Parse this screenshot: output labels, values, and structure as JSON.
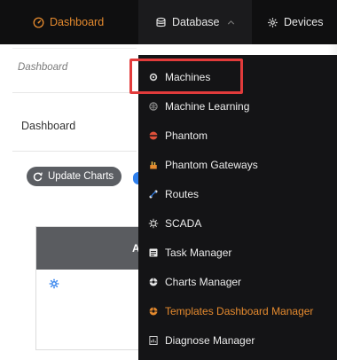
{
  "nav": {
    "dashboard": "Dashboard",
    "database": "Database",
    "devices": "Devices"
  },
  "page": {
    "breadcrumb": "Dashboard",
    "section_title": "Dashboard",
    "update_button": "Update Charts",
    "card_header_partial": "Al"
  },
  "menu": {
    "items": [
      {
        "label": "Machines",
        "icon": "machine-icon"
      },
      {
        "label": "Machine Learning",
        "icon": "brain-icon"
      },
      {
        "label": "Phantom",
        "icon": "phantom-icon"
      },
      {
        "label": "Phantom Gateways",
        "icon": "gateway-icon"
      },
      {
        "label": "Routes",
        "icon": "route-icon"
      },
      {
        "label": "SCADA",
        "icon": "scada-icon"
      },
      {
        "label": "Task Manager",
        "icon": "task-icon"
      },
      {
        "label": "Charts Manager",
        "icon": "charts-icon"
      },
      {
        "label": "Templates Dashboard Manager",
        "icon": "templates-icon"
      },
      {
        "label": "Diagnose Manager",
        "icon": "diagnose-icon"
      }
    ]
  },
  "colors": {
    "accent": "#e58a2e",
    "nav_bg": "#0f0f10",
    "menu_bg": "#141416",
    "highlight": "#e23b3b",
    "button_bg": "#5b5e63"
  }
}
